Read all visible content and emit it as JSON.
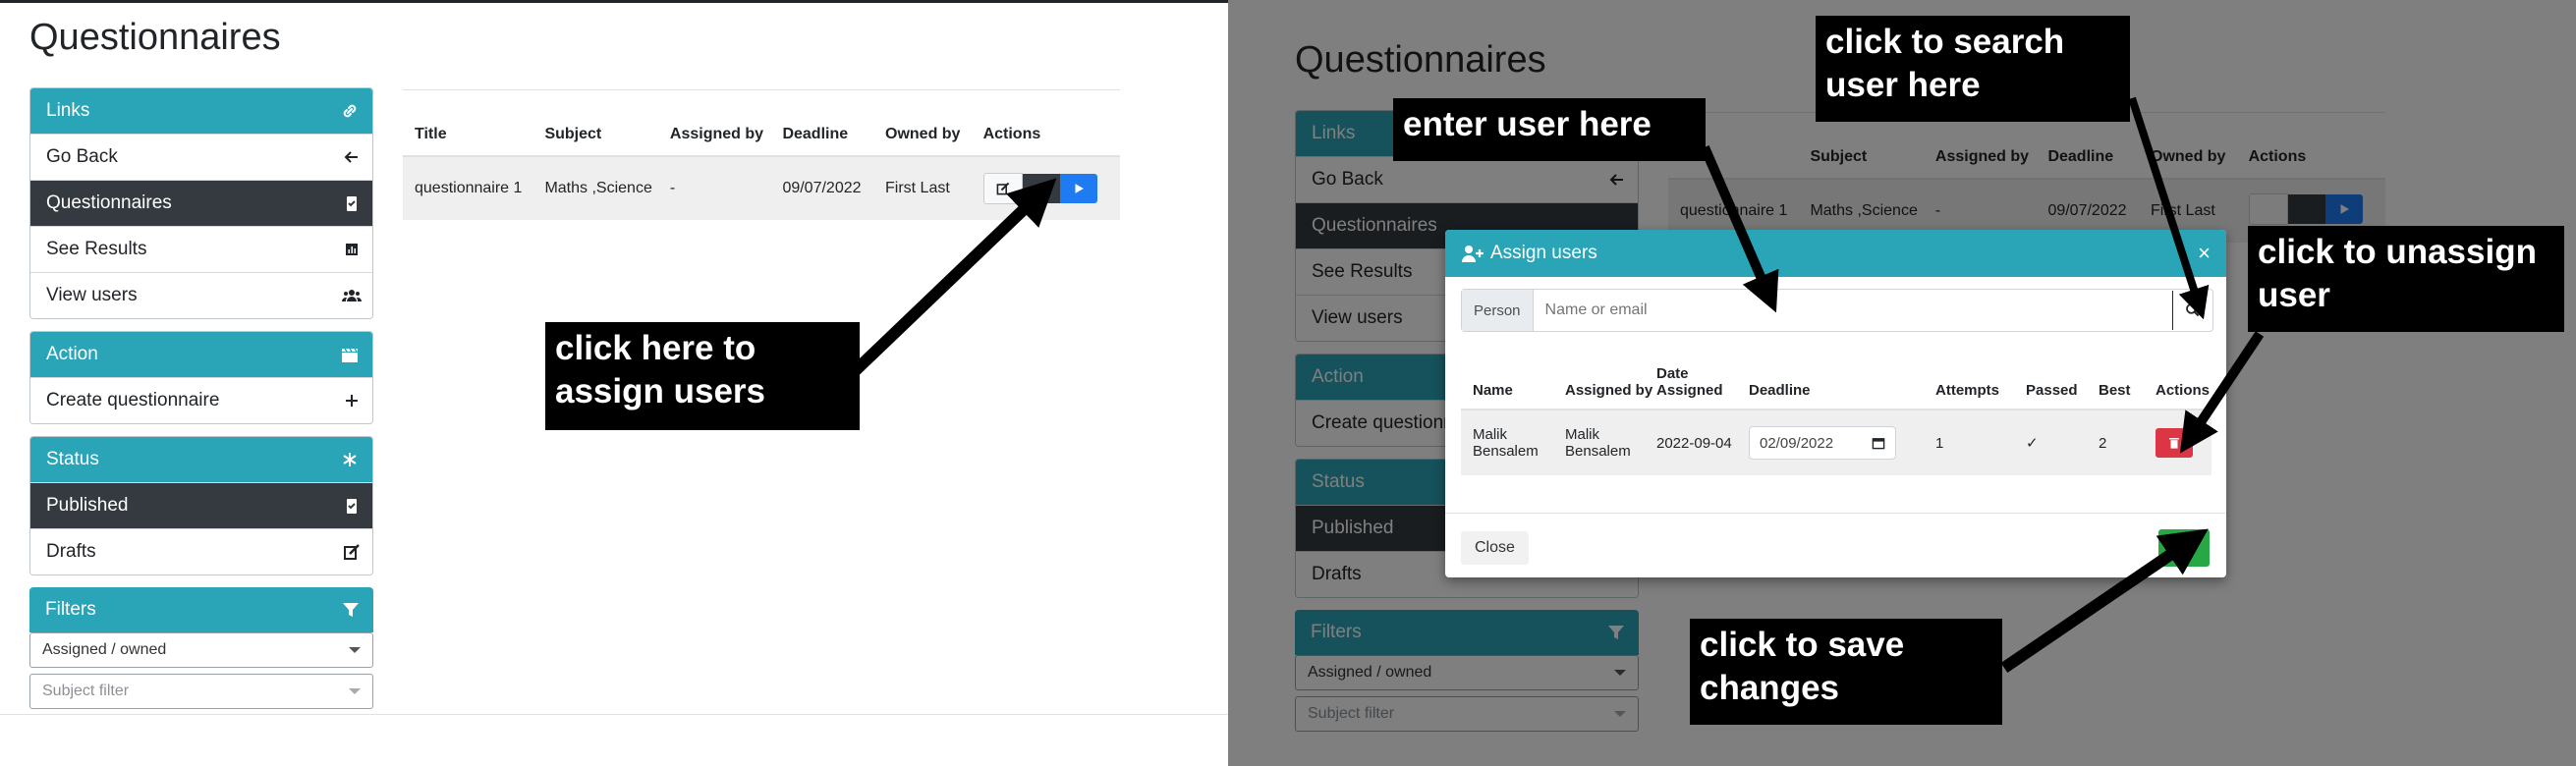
{
  "page": {
    "title": "Questionnaires"
  },
  "sidebar": {
    "links": {
      "header": "Links",
      "items": [
        {
          "label": "Go Back",
          "icon": "arrow-left-icon",
          "active": false
        },
        {
          "label": "Questionnaires",
          "icon": "clipboard-icon",
          "active": true
        },
        {
          "label": "See Results",
          "icon": "chart-icon",
          "active": false
        },
        {
          "label": "View users",
          "icon": "users-icon",
          "active": false
        }
      ]
    },
    "action": {
      "header": "Action",
      "items": [
        {
          "label": "Create questionnaire",
          "icon": "plus-icon"
        }
      ]
    },
    "status": {
      "header": "Status",
      "items": [
        {
          "label": "Published",
          "icon": "clipboard-icon",
          "active": true
        },
        {
          "label": "Drafts",
          "icon": "edit-icon",
          "active": false
        }
      ]
    },
    "filters": {
      "header": "Filters",
      "assigned": "Assigned / owned",
      "subject_placeholder": "Subject filter"
    }
  },
  "table": {
    "headers": [
      "Title",
      "Subject",
      "Assigned by",
      "Deadline",
      "Owned by",
      "Actions"
    ],
    "rows": [
      [
        "questionnaire 1",
        "Maths ,Science",
        "-",
        "09/07/2022",
        "First Last"
      ]
    ]
  },
  "modal": {
    "title": "Assign users",
    "close_symbol": "×",
    "person_label": "Person",
    "person_placeholder": "Name or email",
    "headers": [
      "Name",
      "Assigned by",
      "Date Assigned",
      "Deadline",
      "Attempts",
      "Passed",
      "Best",
      "Actions"
    ],
    "row": {
      "name": "Malik Bensalem",
      "assigned_by": "Malik Bensalem",
      "date_assigned": "2022-09-04",
      "deadline": "02/09/2022",
      "attempts": "1",
      "passed": "✓",
      "best": "2"
    },
    "close_label": "Close"
  },
  "callouts": {
    "assign": "click here to assign users",
    "enter_user": "enter user here",
    "search_user": "click to search user here",
    "unassign": "click to unassign user",
    "save": "click to save changes"
  },
  "colors": {
    "accent": "#2aa5b8",
    "dark": "#343a40",
    "primary": "#1e7bf2",
    "danger": "#dc3545",
    "success": "#28a745"
  }
}
